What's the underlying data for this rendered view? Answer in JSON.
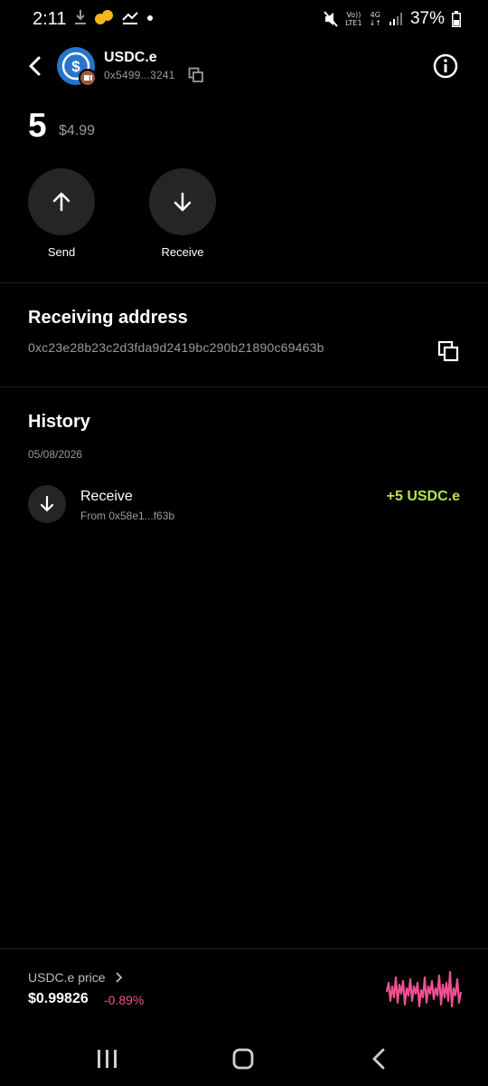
{
  "status_bar": {
    "time": "2:11",
    "network_top": "Vo))",
    "network_bottom": "LTE1",
    "signal_label": "4G",
    "battery_percent": "37%",
    "icons": [
      "download-icon",
      "app-icon",
      "hands-icon",
      "dot-icon",
      "mute-icon",
      "signal-icon",
      "battery-icon"
    ]
  },
  "header": {
    "token_name": "USDC.e",
    "token_address": "0x5499...3241",
    "icons": [
      "back-icon",
      "usdc-logo-icon",
      "chain-badge-icon",
      "copy-icon",
      "info-icon"
    ]
  },
  "balance": {
    "amount": "5",
    "usd_value": "$4.99"
  },
  "actions": [
    {
      "label": "Send",
      "icon": "arrow-up-icon"
    },
    {
      "label": "Receive",
      "icon": "arrow-down-icon"
    }
  ],
  "receiving": {
    "title": "Receiving address",
    "address": "0xc23e28b23c2d3fda9d2419bc290b21890c69463b"
  },
  "history": {
    "title": "History",
    "date": "05/08/2026",
    "items": [
      {
        "title": "Receive",
        "subtitle": "From 0x58e1...f63b",
        "amount": "+5 USDC.e",
        "icon": "arrow-down-icon"
      }
    ]
  },
  "price": {
    "label": "USDC.e price",
    "value": "$0.99826",
    "change": "-0.89%",
    "accent_color": "#f0508f"
  },
  "colors": {
    "background": "#000000",
    "surface": "#252525",
    "positive": "#b5e34a",
    "negative": "#f0508f",
    "muted_text": "#9a9a9a"
  },
  "nav": {
    "buttons": [
      "recent-apps-icon",
      "home-icon",
      "back-nav-icon"
    ]
  }
}
